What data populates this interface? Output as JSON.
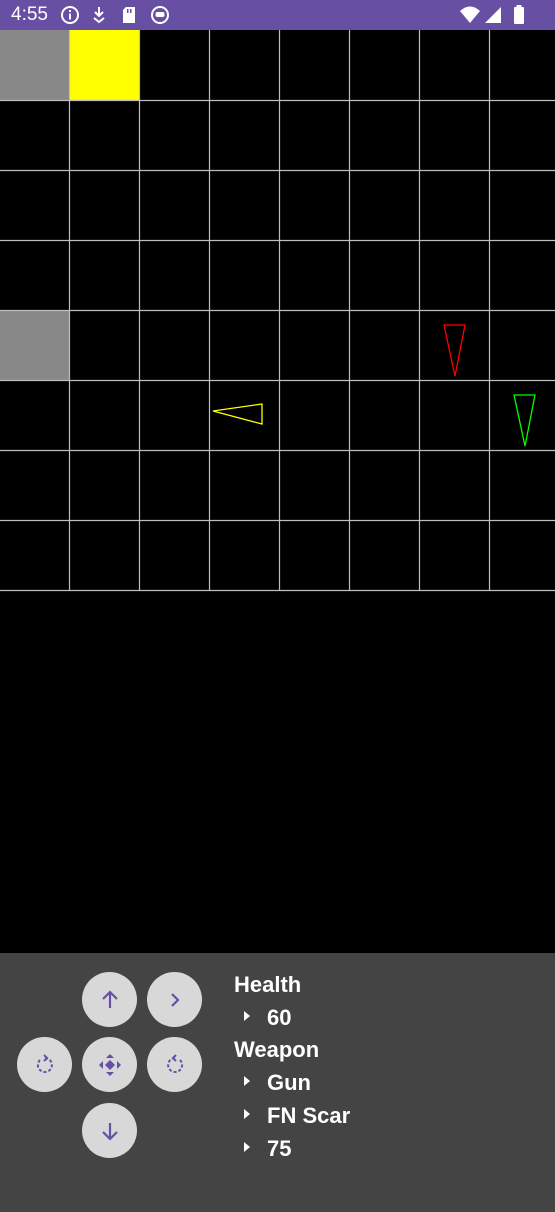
{
  "status_bar": {
    "time": "4:55",
    "bg_color": "#6750a4",
    "left_icons": [
      "info-icon",
      "download-icon",
      "sd-card-icon",
      "app-notification-icon"
    ],
    "right_icons": [
      "wifi-icon",
      "signal-icon",
      "battery-icon"
    ]
  },
  "board": {
    "columns": 8,
    "rows": 8,
    "grid_color": "#bdbdbd",
    "cell_color": "#000000",
    "colored_cells": [
      {
        "row": 0,
        "col": 0,
        "color": "#888888"
      },
      {
        "row": 0,
        "col": 1,
        "color": "#ffff00"
      },
      {
        "row": 4,
        "col": 0,
        "color": "#888888"
      }
    ],
    "pieces": [
      {
        "name": "yellow-triangle",
        "color": "#ffff00",
        "row": 5,
        "col": 3,
        "facing": "left"
      },
      {
        "name": "red-triangle",
        "color": "#ff0000",
        "row": 4,
        "col": 6,
        "facing": "down"
      },
      {
        "name": "green-triangle",
        "color": "#00ff00",
        "row": 5,
        "col": 7,
        "facing": "down"
      }
    ]
  },
  "controls": {
    "button_color": "#d8d8d8",
    "icon_color": "#6750a4",
    "buttons": [
      "move-up",
      "turn-right",
      "rotate-left",
      "center",
      "rotate-right",
      "move-down"
    ]
  },
  "info": {
    "health_label": "Health",
    "health_value": "60",
    "weapon_label": "Weapon",
    "weapon_type": "Gun",
    "weapon_name": "FN Scar",
    "weapon_ammo": "75"
  }
}
